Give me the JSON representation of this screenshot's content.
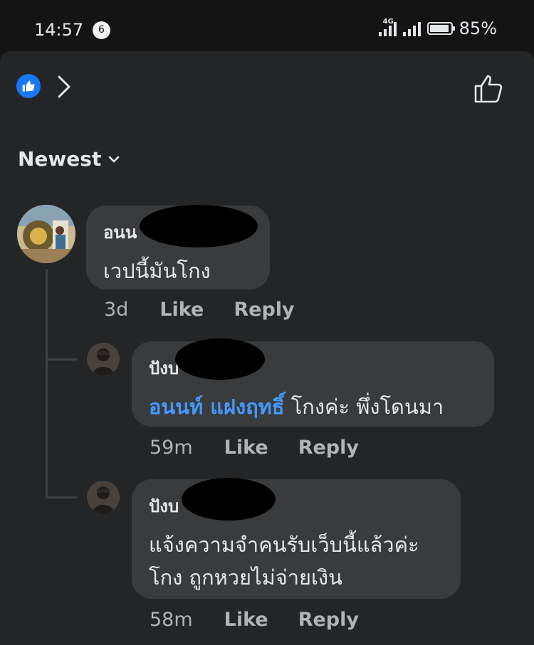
{
  "status": {
    "time": "14:57",
    "notification_count": "6",
    "network": "4G",
    "battery": "85%"
  },
  "header": {
    "reaction_icon": "like-icon",
    "chevron_icon": "chevron-right-icon",
    "like_button_icon": "thumbs-up-outline-icon"
  },
  "sort": {
    "label": "Newest",
    "icon": "chevron-down-icon"
  },
  "comments": [
    {
      "name": "อนน",
      "text": "เวปนี้มันโกง",
      "time": "3d",
      "like": "Like",
      "reply": "Reply"
    },
    {
      "name": "ปังบ",
      "mention": "อนนท์ แฝงฤทธิ์",
      "text": " โกงค่ะ พึ่งโดนมา",
      "time": "59m",
      "like": "Like",
      "reply": "Reply"
    },
    {
      "name": "ปังบ",
      "text_line1": "แจ้งความจำคนรับเว็บนี้แล้วค่ะ",
      "text_line2": "โกง ถูกหวยไม่จ่ายเงิน",
      "time": "58m",
      "like": "Like",
      "reply": "Reply"
    }
  ],
  "colors": {
    "background": "#242526",
    "bubble": "#3a3b3c",
    "mention": "#4599ff",
    "like_badge": "#1877f2",
    "muted": "#b0b3b8"
  }
}
